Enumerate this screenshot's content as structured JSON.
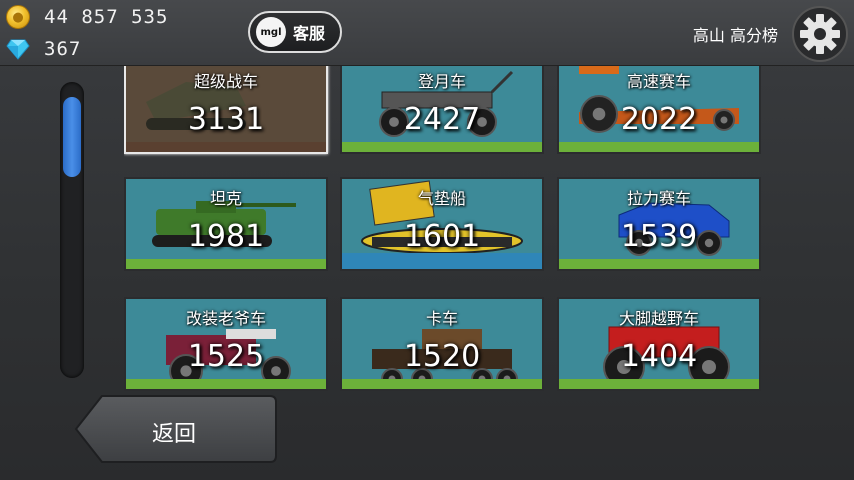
{
  "currency": {
    "coins": "44 857 535",
    "gems": "367",
    "coin_icon": "coin-icon",
    "gem_icon": "diamond-icon"
  },
  "header": {
    "support_label": "客服",
    "support_badge": "mgl",
    "leaderboard_title": "高山 高分榜"
  },
  "scroll": {
    "position": 0.03,
    "visible_fraction": 0.28
  },
  "colors": {
    "accent": "#3b7fda",
    "ground": "#6cb13a",
    "sky": "#3d7f88"
  },
  "vehicles": [
    {
      "name": "超级战车",
      "score": "3131",
      "selected": true
    },
    {
      "name": "登月车",
      "score": "2427",
      "selected": false
    },
    {
      "name": "高速赛车",
      "score": "2022",
      "selected": false
    },
    {
      "name": "坦克",
      "score": "1981",
      "selected": false
    },
    {
      "name": "气垫船",
      "score": "1601",
      "selected": false
    },
    {
      "name": "拉力赛车",
      "score": "1539",
      "selected": false
    },
    {
      "name": "改装老爷车",
      "score": "1525",
      "selected": false
    },
    {
      "name": "卡车",
      "score": "1520",
      "selected": false
    },
    {
      "name": "大脚越野车",
      "score": "1404",
      "selected": false
    }
  ],
  "footer": {
    "back_label": "返回"
  }
}
